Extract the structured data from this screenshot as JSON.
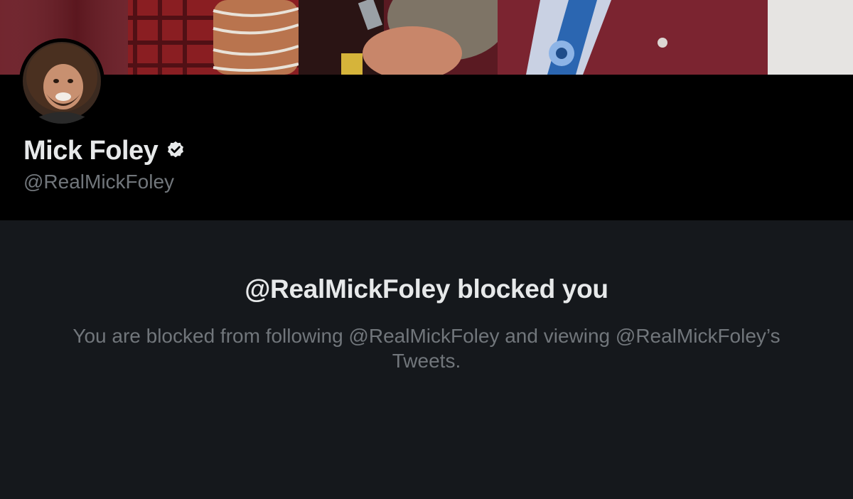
{
  "profile": {
    "display_name": "Mick Foley",
    "handle": "@RealMickFoley",
    "verified": true,
    "verified_icon": "verified-badge-icon"
  },
  "blocked": {
    "title": "@RealMickFoley blocked you",
    "description": "You are blocked from following @RealMickFoley and viewing @RealMickFoley’s Tweets."
  },
  "colors": {
    "header_background": "#000000",
    "page_background": "#15181c",
    "primary_text": "#e7e9ea",
    "secondary_text": "#71767b"
  }
}
